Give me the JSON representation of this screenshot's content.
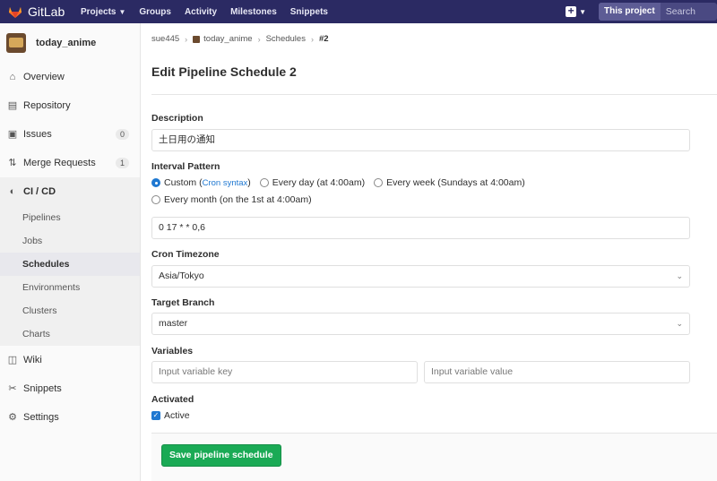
{
  "navbar": {
    "brand": "GitLab",
    "links": [
      {
        "label": "Projects",
        "has_dropdown": true
      },
      {
        "label": "Groups"
      },
      {
        "label": "Activity"
      },
      {
        "label": "Milestones"
      },
      {
        "label": "Snippets"
      }
    ],
    "search_scope": "This project",
    "search_placeholder": "Search"
  },
  "sidebar": {
    "project_name": "today_anime",
    "items": [
      {
        "label": "Overview",
        "icon": "home-icon"
      },
      {
        "label": "Repository",
        "icon": "doc-icon"
      },
      {
        "label": "Issues",
        "icon": "issues-icon",
        "badge": "0"
      },
      {
        "label": "Merge Requests",
        "icon": "merge-icon",
        "badge": "1"
      },
      {
        "label": "CI / CD",
        "icon": "rocket-icon"
      }
    ],
    "cicd_sub": [
      "Pipelines",
      "Jobs",
      "Schedules",
      "Environments",
      "Clusters",
      "Charts"
    ],
    "bottom_items": [
      {
        "label": "Wiki",
        "icon": "book-icon"
      },
      {
        "label": "Snippets",
        "icon": "scissors-icon"
      },
      {
        "label": "Settings",
        "icon": "gear-icon"
      }
    ]
  },
  "breadcrumb": [
    "sue445",
    "today_anime",
    "Schedules",
    "#2"
  ],
  "page_title": "Edit Pipeline Schedule 2",
  "form": {
    "description_label": "Description",
    "description_value": "土日用の通知",
    "interval_label": "Interval Pattern",
    "interval_options": {
      "custom": "Custom (",
      "cron_link": "Cron syntax",
      "custom_close": ")",
      "daily": "Every day (at 4:00am)",
      "weekly": "Every week (Sundays at 4:00am)",
      "monthly": "Every month (on the 1st at 4:00am)"
    },
    "selected_interval": "custom",
    "cron_value": "0 17 * * 0,6",
    "timezone_label": "Cron Timezone",
    "timezone_value": "Asia/Tokyo",
    "branch_label": "Target Branch",
    "branch_value": "master",
    "variables_label": "Variables",
    "var_key_placeholder": "Input variable key",
    "var_value_placeholder": "Input variable value",
    "activated_label": "Activated",
    "active_checkbox_label": "Active",
    "active_checked": true,
    "save_label": "Save pipeline schedule"
  },
  "colors": {
    "navbar": "#2b2a63",
    "accent": "#1f78d1",
    "save": "#1aaa55"
  }
}
